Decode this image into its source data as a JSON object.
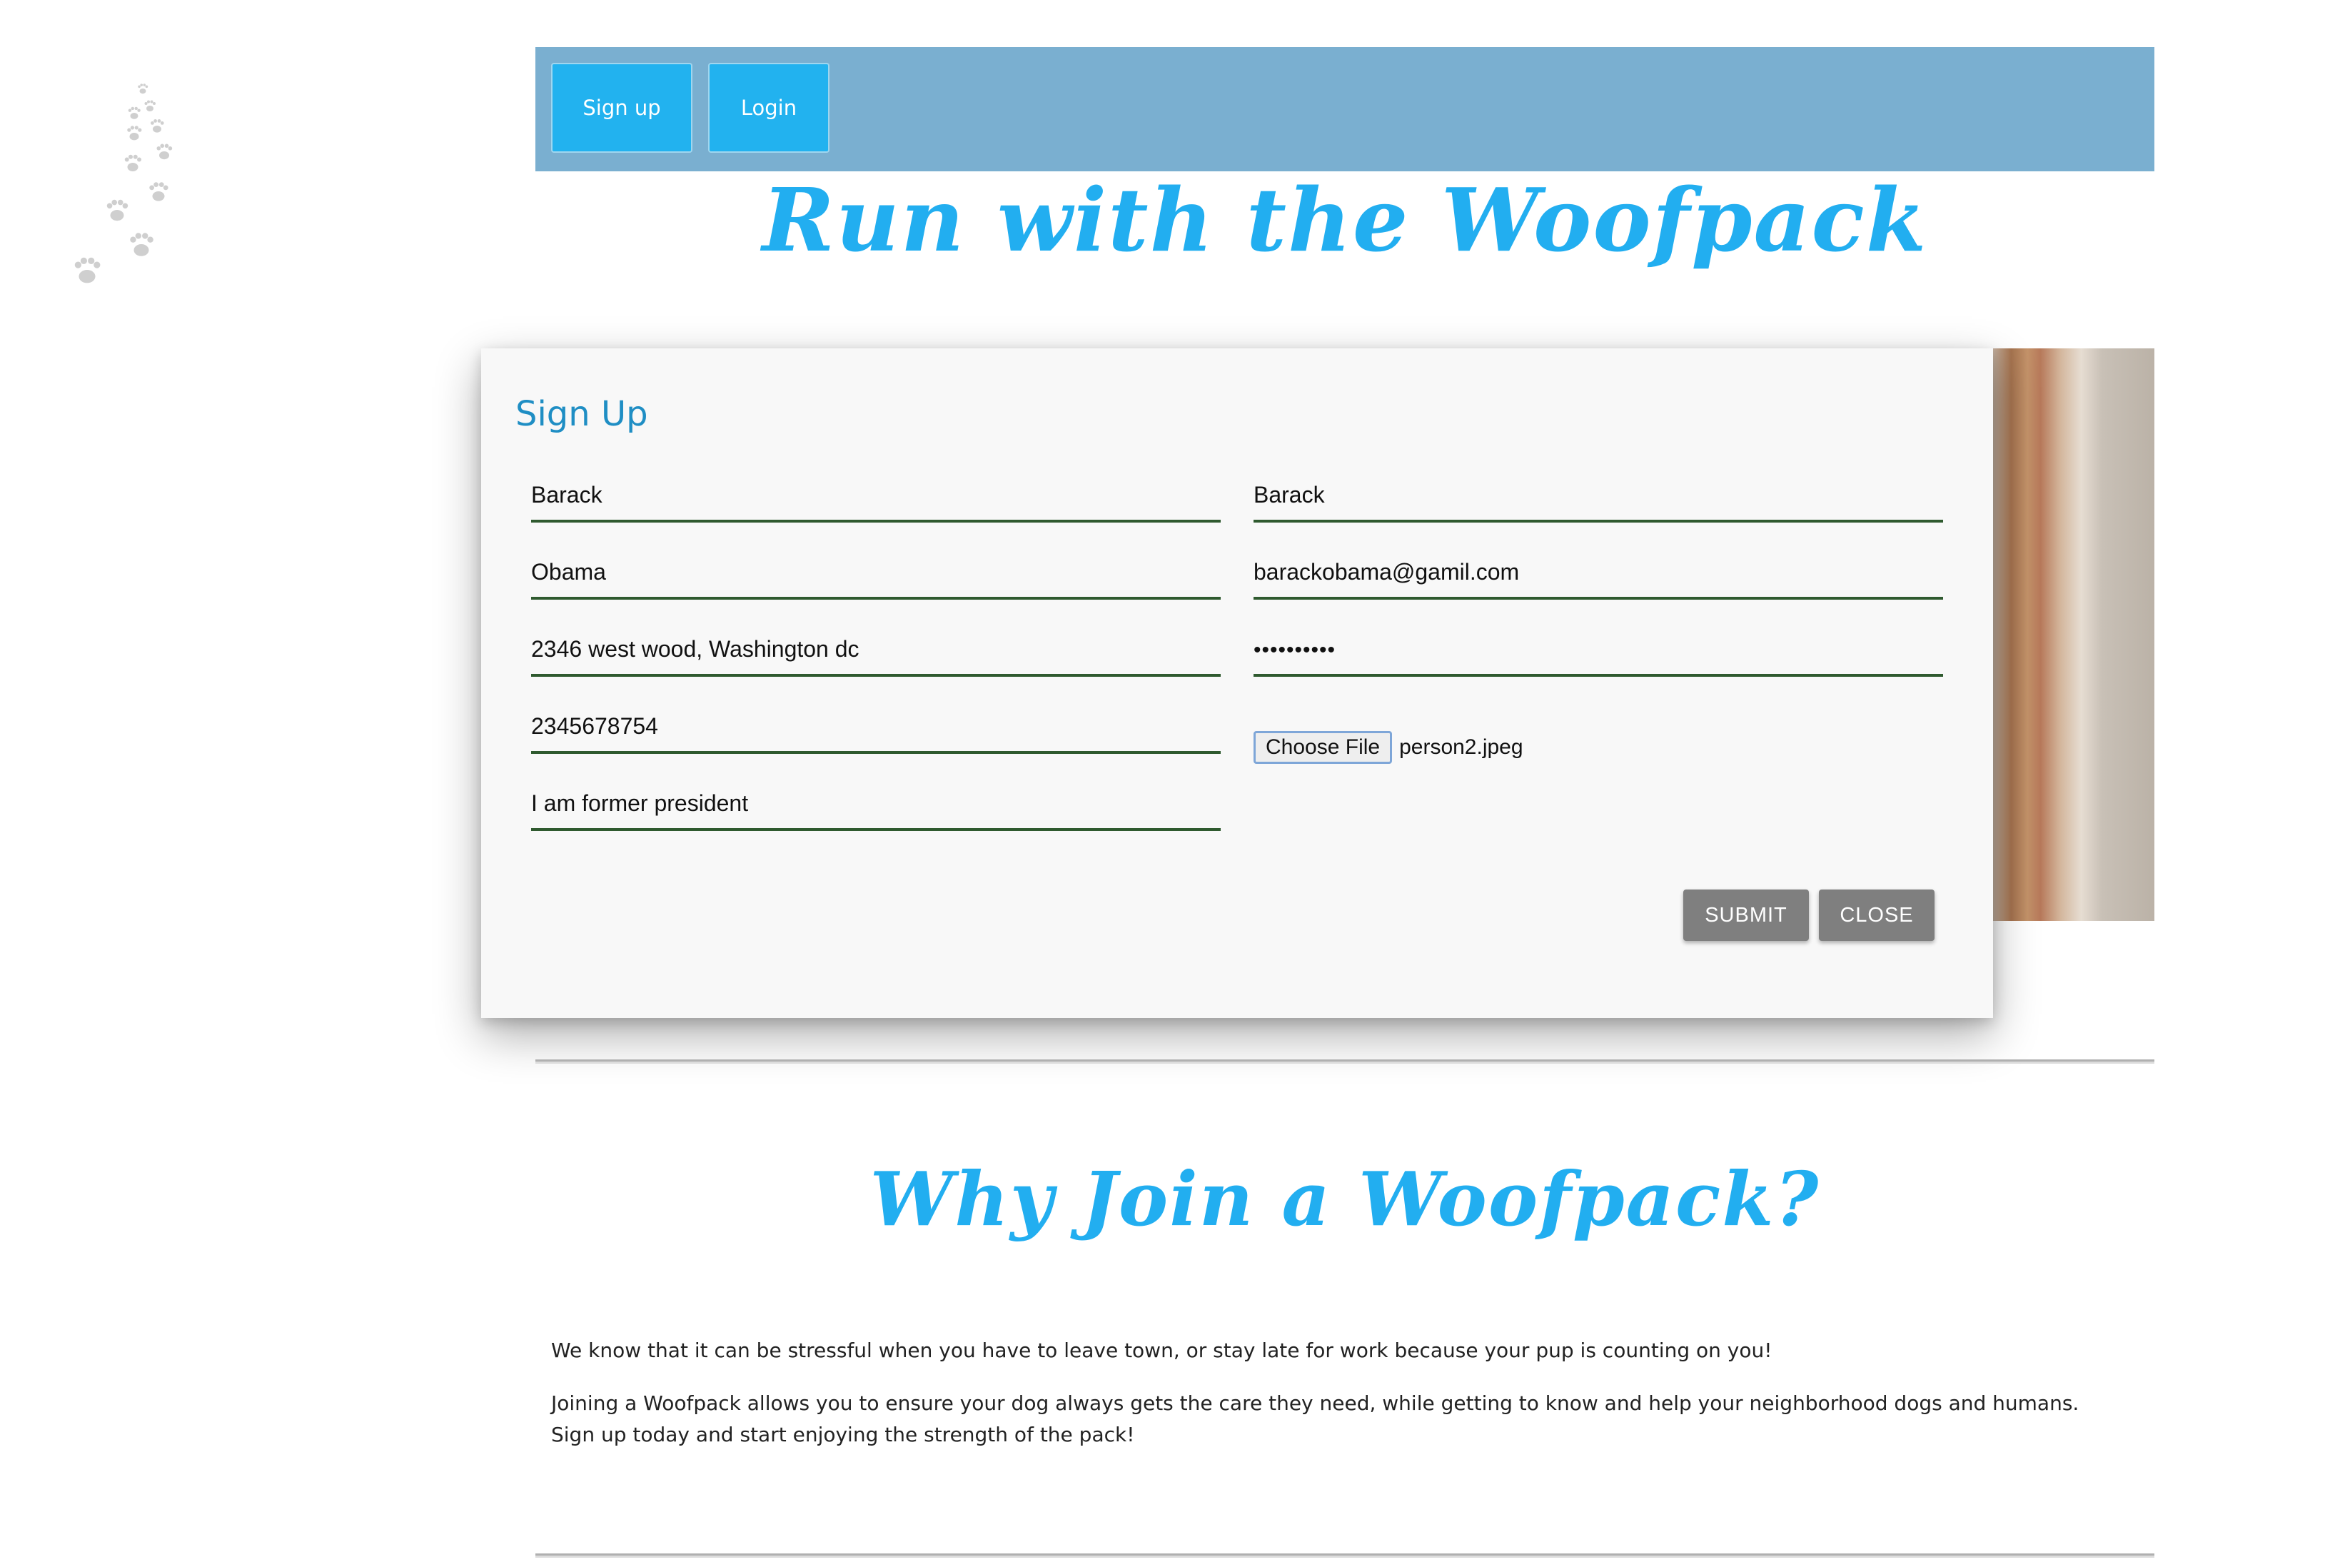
{
  "nav": {
    "signup_label": "Sign up",
    "login_label": "Login"
  },
  "hero": {
    "title": "Run with the Woofpack"
  },
  "signup_modal": {
    "title": "Sign Up",
    "fields": {
      "first_name": "Barack",
      "last_name": "Obama",
      "address": "2346 west wood, Washington dc",
      "phone": "2345678754",
      "bio": "I am former president",
      "username": "Barack",
      "email": "barackobama@gamil.com",
      "password": "••••••••••"
    },
    "file": {
      "button_label": "Choose File",
      "filename": "person2.jpeg"
    },
    "submit_label": "SUBMIT",
    "close_label": "CLOSE"
  },
  "why": {
    "title": "Why Join a Woofpack?",
    "paragraph1": "We know that it can be stressful when you have to leave town, or stay late for work because your pup is counting on you!",
    "paragraph2": "Joining a Woofpack allows you to ensure your dog always gets the care they need, while getting to know and help your neighborhood dogs and humans. Sign up today and start enjoying the strength of the pack!"
  },
  "colors": {
    "navbar": "#7aafd0",
    "accent": "#22b2ef",
    "heading": "#22aef0",
    "modal_title": "#1f8ec4",
    "field_underline": "#2f5a2f",
    "action_button": "#7f7f7f"
  },
  "icons": {
    "decoration": "paw-prints-icon"
  }
}
